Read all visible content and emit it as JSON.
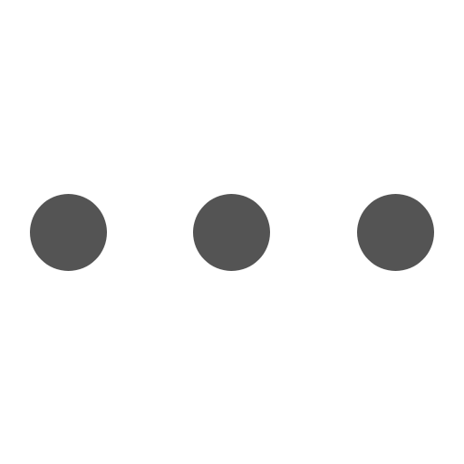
{
  "icon": {
    "name": "more-horizontal-icon",
    "color": "#545454",
    "background": "#ffffff",
    "dot_count": 3
  }
}
